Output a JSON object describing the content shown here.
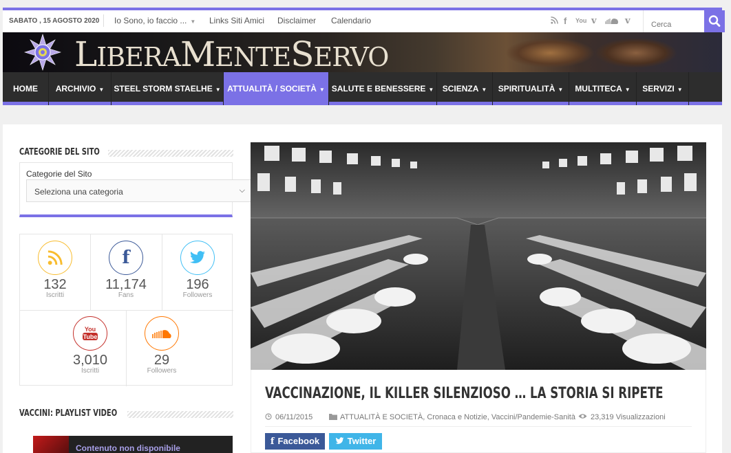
{
  "topbar": {
    "date": "SABATO , 15 AGOSTO 2020",
    "links": [
      "Io Sono, io faccio ...",
      "Links Siti Amici",
      "Disclaimer",
      "Calendario"
    ],
    "search_placeholder": "Cerca"
  },
  "brand": {
    "l1": "L",
    "w1": "IBERA",
    "l2": "M",
    "w2": "ENTE",
    "l3": "S",
    "w3": "ERVO"
  },
  "nav": [
    "HOME",
    "ARCHIVIO",
    "STEEL STORM STAELHE",
    "ATTUALITÀ / SOCIETÀ",
    "SALUTE E BENESSERE",
    "SCIENZA",
    "SPIRITUALITÀ",
    "MULTITECA",
    "SERVIZI"
  ],
  "sidebar": {
    "categories_title": "CATEGORIE DEL SITO",
    "categories_label": "Categorie del Sito",
    "categories_select": "Seleziona una categoria",
    "social": [
      {
        "count": "132",
        "label": "Iscritti",
        "icon": "rss-icon",
        "color": "#f8bc2e"
      },
      {
        "count": "11,174",
        "label": "Fans",
        "icon": "facebook-icon",
        "color": "#3b5998"
      },
      {
        "count": "196",
        "label": "Followers",
        "icon": "twitter-icon",
        "color": "#40bff5"
      },
      {
        "count": "3,010",
        "label": "Iscritti",
        "icon": "youtube-icon",
        "color": "#c4302b"
      },
      {
        "count": "29",
        "label": "Followers",
        "icon": "soundcloud-icon",
        "color": "#ff7700"
      }
    ],
    "videos_title": "VACCINI: PLAYLIST VIDEO",
    "video_text": "Contenuto non disponibile"
  },
  "article": {
    "title": "VACCINAZIONE, IL KILLER SILENZIOSO … LA STORIA SI RIPETE",
    "date": "06/11/2015",
    "categories": "ATTUALITÀ E SOCIETÀ, Cronaca e Notizie, Vaccini/Pandemie-Sanità",
    "views": "23,319 Visualizzazioni",
    "share_facebook": "Facebook",
    "share_twitter": "Twitter"
  },
  "colors": {
    "accent": "#7b71e6",
    "nav_bg": "#2d2d2d"
  }
}
